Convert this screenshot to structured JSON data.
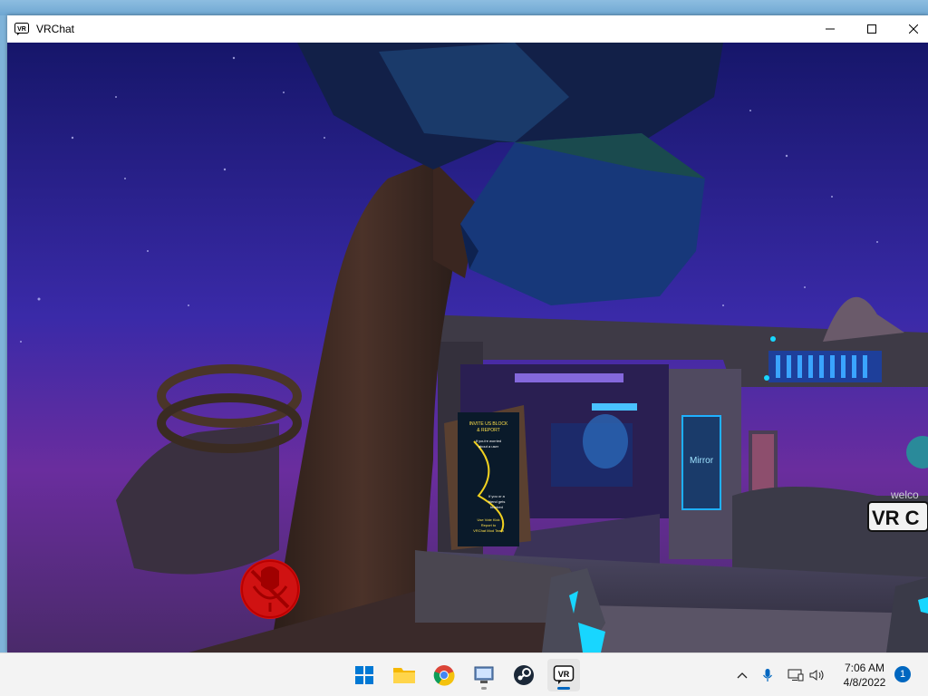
{
  "window": {
    "title": "VRChat",
    "icon": "vrchat-logo-icon",
    "controls": [
      "minimize-icon",
      "maximize-icon",
      "close-icon"
    ]
  },
  "scene": {
    "poster_lines": [
      "INVITE US BLOCK",
      "& REPORT",
      "If you're worried",
      "about a user",
      "If you or a",
      "friend gets",
      "blocked",
      "Use Vote Kick",
      "Report to",
      "VRChat Mod Team"
    ],
    "mirror_label": "Mirror",
    "welcome_text": "welco",
    "vr_sign_text": "VR C",
    "mute_indicator": "microphone-muted-icon"
  },
  "taskbar": {
    "apps": [
      {
        "name": "start",
        "icon": "windows-start-icon"
      },
      {
        "name": "file-explorer",
        "icon": "folder-icon"
      },
      {
        "name": "chrome",
        "icon": "chrome-icon"
      },
      {
        "name": "remote-desktop",
        "icon": "remote-desktop-icon"
      },
      {
        "name": "steam",
        "icon": "steam-icon"
      },
      {
        "name": "vrchat",
        "icon": "vrchat-icon",
        "active": true
      }
    ],
    "tray": [
      "chevron-up-icon",
      "microphone-icon",
      "display-icon",
      "speaker-icon"
    ],
    "time": "7:06 AM",
    "date": "4/8/2022",
    "notification_count": "1"
  },
  "colors": {
    "accent": "#0067c0",
    "sky_top": "#1a1a6e",
    "sky_bottom": "#6a2d9e",
    "mute_red": "#d01212",
    "cyan": "#18d6ff"
  }
}
